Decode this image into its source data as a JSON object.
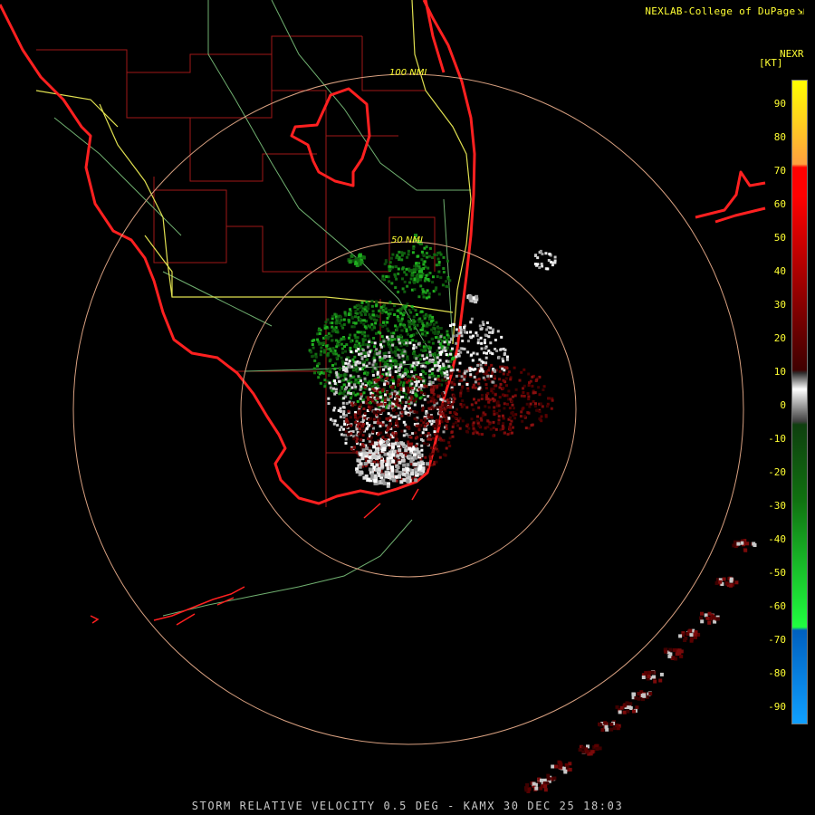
{
  "header": {
    "credit": "NEXLAB-College of DuPage",
    "credit_mark_icon": "diagonal-arrow-icon"
  },
  "footer": {
    "caption": "STORM RELATIVE VELOCITY 0.5 DEG - KAMX 30 DEC 25 18:03"
  },
  "range_rings": [
    {
      "label": "100 NMI"
    },
    {
      "label": "50 NMI"
    }
  ],
  "color_scale": {
    "product": "NEXR",
    "unit": "[KT]",
    "ticks": [
      "90",
      "80",
      "70",
      "60",
      "50",
      "40",
      "30",
      "20",
      "10",
      "0",
      "-10",
      "-20",
      "-30",
      "-40",
      "-50",
      "-60",
      "-70",
      "-80",
      "-90"
    ],
    "colors": {
      "top": "#ffff00",
      "upper": "#ff9f3f",
      "outbound_strong": "#ff0000",
      "outbound_dark": "#3f0000",
      "near_zero": "#ffffff",
      "inbound_dark": "#0f3f0f",
      "inbound_bright": "#20ff40",
      "inbound_extreme": "#0060c0",
      "bottom": "#10a0ff"
    }
  },
  "map_colors": {
    "coastline": "#ff2020",
    "county_lines": "#b02020",
    "highways": "#e0e060",
    "roads": "#80c080",
    "range_rings": "#d8a080"
  }
}
